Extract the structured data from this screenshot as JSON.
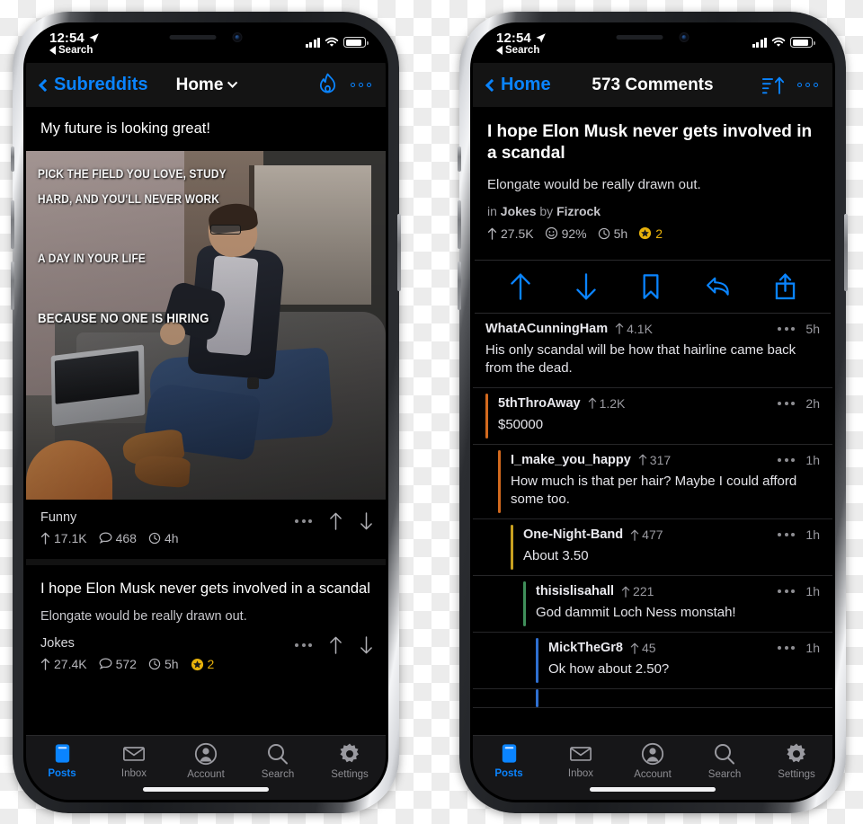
{
  "app": {
    "name": "Reddit client (dark)"
  },
  "colors": {
    "accent_blue": "#0a84ff",
    "gold": "#e8b20b",
    "depth_orange": "#d2691e",
    "depth_gold": "#c8a020",
    "depth_green": "#3f8f5a",
    "depth_blue": "#2f6fd0"
  },
  "status_bar": {
    "time": "12:54",
    "back_label": "Search",
    "location_icon": "location-arrow-icon",
    "signal_icon": "cellular-bars-icon",
    "wifi_icon": "wifi-icon",
    "battery_icon": "battery-icon"
  },
  "left_phone": {
    "nav": {
      "back_label": "Subreddits",
      "title": "Home",
      "chevron_icon": "chevron-down-icon",
      "flame_icon": "flame-icon",
      "more_icon": "more-dots-icon"
    },
    "posts": [
      {
        "title": "My future is looking great!",
        "has_image": true,
        "meme_lines": [
          "PICK THE FIELD YOU LOVE, STUDY",
          "HARD, AND YOU'LL NEVER WORK",
          "A DAY IN YOUR LIFE",
          "BECAUSE NO ONE IS HIRING"
        ],
        "subreddit": "Funny",
        "score": "17.1K",
        "comments": "468",
        "age": "4h",
        "awards": null
      },
      {
        "title": "I hope Elon Musk never gets involved in a scandal",
        "body": "Elongate would be really drawn out.",
        "has_image": false,
        "subreddit": "Jokes",
        "score": "27.4K",
        "comments": "572",
        "age": "5h",
        "awards": "2"
      }
    ]
  },
  "right_phone": {
    "nav": {
      "back_label": "Home",
      "title": "573 Comments",
      "sort_icon": "sort-ascending-icon",
      "more_icon": "more-dots-icon"
    },
    "post": {
      "title": "I hope Elon Musk never gets involved in a scandal",
      "body": "Elongate would be really drawn out.",
      "in_label": "in",
      "subreddit": "Jokes",
      "by_label": "by",
      "author": "Fizrock",
      "score": "27.5K",
      "upvote_ratio": "92%",
      "age": "5h",
      "awards": "2"
    },
    "actions": [
      {
        "name": "upvote-button",
        "icon": "arrow-up-icon"
      },
      {
        "name": "downvote-button",
        "icon": "arrow-down-icon"
      },
      {
        "name": "save-button",
        "icon": "bookmark-icon"
      },
      {
        "name": "reply-button",
        "icon": "reply-arrow-icon"
      },
      {
        "name": "share-button",
        "icon": "share-icon"
      }
    ],
    "comments": [
      {
        "user": "WhatACunningHam",
        "score": "4.1K",
        "age": "5h",
        "text": "His only scandal will be how that hairline came back from the dead.",
        "depth": 0
      },
      {
        "user": "5thThroAway",
        "score": "1.2K",
        "age": "2h",
        "text": "$50000",
        "depth": 1
      },
      {
        "user": "I_make_you_happy",
        "score": "317",
        "age": "1h",
        "text": "How much is that per hair? Maybe I could afford some too.",
        "depth": 2
      },
      {
        "user": "One-Night-Band",
        "score": "477",
        "age": "1h",
        "text": "About 3.50",
        "depth": 3
      },
      {
        "user": "thisislisahall",
        "score": "221",
        "age": "1h",
        "text": "God dammit Loch Ness monstah!",
        "depth": 4
      },
      {
        "user": "MickTheGr8",
        "score": "45",
        "age": "1h",
        "text": "Ok how about 2.50?",
        "depth": 5
      }
    ]
  },
  "tabbar": {
    "items": [
      {
        "label": "Posts",
        "icon": "posts-icon",
        "active": true
      },
      {
        "label": "Inbox",
        "icon": "envelope-icon",
        "active": false
      },
      {
        "label": "Account",
        "icon": "person-circle-icon",
        "active": false
      },
      {
        "label": "Search",
        "icon": "magnifier-icon",
        "active": false
      },
      {
        "label": "Settings",
        "icon": "gear-icon",
        "active": false
      }
    ]
  }
}
